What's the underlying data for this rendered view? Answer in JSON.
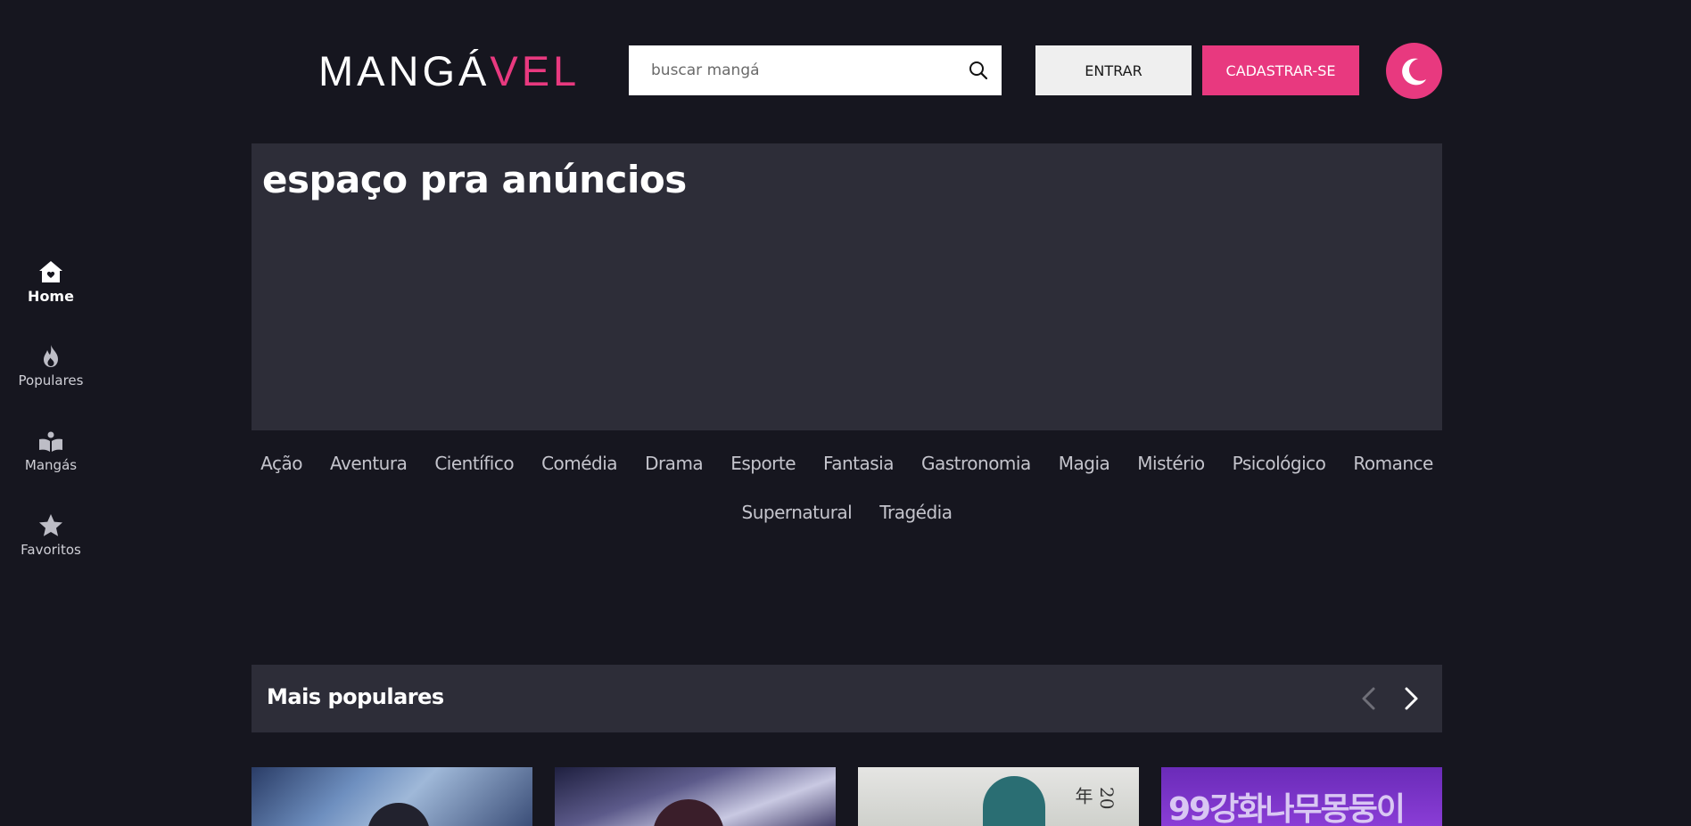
{
  "brand": {
    "logo_part1": "MANGÁ",
    "logo_part2": "VEL",
    "accent_color": "#e8397f"
  },
  "search": {
    "placeholder": "buscar mangá",
    "icon": "search-icon"
  },
  "header": {
    "login_label": "ENTRAR",
    "signup_label": "CADASTRAR-SE",
    "theme_icon": "moon-icon"
  },
  "sidebar": {
    "items": [
      {
        "label": "Home",
        "icon": "home-icon",
        "active": true
      },
      {
        "label": "Populares",
        "icon": "fire-icon",
        "active": false
      },
      {
        "label": "Mangás",
        "icon": "book-icon",
        "active": false
      },
      {
        "label": "Favoritos",
        "icon": "star-icon",
        "active": false
      }
    ]
  },
  "ad": {
    "text": "espaço pra anúncios"
  },
  "genres": [
    "Ação",
    "Aventura",
    "Científico",
    "Comédia",
    "Drama",
    "Esporte",
    "Fantasia",
    "Gastronomia",
    "Magia",
    "Mistério",
    "Psicológico",
    "Romance",
    "Supernatural",
    "Tragédia"
  ],
  "popular": {
    "title": "Mais populares",
    "cards": [
      {
        "cover_text": ""
      },
      {
        "cover_text": ""
      },
      {
        "cover_text": "20年"
      },
      {
        "cover_text": "99강화나무몽둥이"
      }
    ]
  }
}
